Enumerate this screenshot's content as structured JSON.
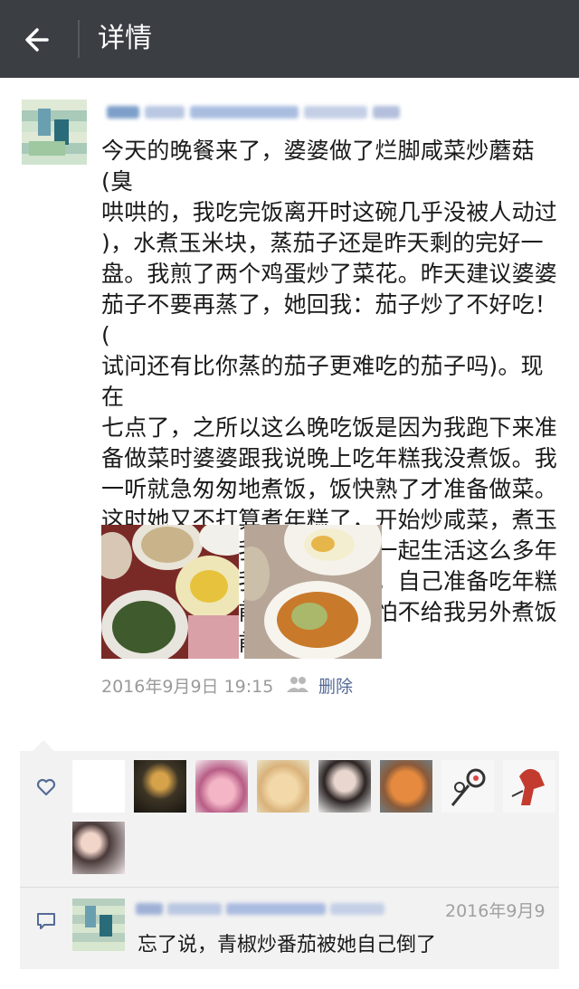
{
  "header": {
    "title": "详情"
  },
  "post": {
    "text": "今天的晚餐来了，婆婆做了烂脚咸菜炒蘑菇(臭\n哄哄的，我吃完饭离开时这碗几乎没被人动过\n)，水煮玉米块，蒸茄子还是昨天剩的完好一\n盘。我煎了两个鸡蛋炒了菜花。昨天建议婆婆\n茄子不要再蒸了，她回我：茄子炒了不好吃！(\n试问还有比你蒸的茄子更难吃的茄子吗)。现在\n七点了，之所以这么晚吃饭是因为我跑下来准\n备做菜时婆婆跟我说晚上吃年糕我没煮饭。我\n一听就急匆匆地煮饭，饭快熟了才准备做菜。\n这时她又不打算煮年糕了，开始炒咸菜，煮玉\n米汤占着锅。我也是费解。一起生活这么多年\n又不是不知道我不爱吃年糕，自己准备吃年糕\n不煮饭也不提前说一声，哪怕不给我另外煮饭\n我也好自己提前煮好啊。",
    "timestamp": "2016年9月9日 19:15",
    "delete_label": "删除"
  },
  "comment": {
    "date": "2016年9月9",
    "text": "忘了说，青椒炒番茄被她自己倒了"
  },
  "icons": {
    "back": "arrow-left-icon",
    "group": "group-visibility-icon",
    "heart": "heart-icon",
    "comment": "comment-icon"
  },
  "colors": {
    "topbar": "#3b3e43",
    "link": "#556b95",
    "panel": "#f2f2f2"
  }
}
